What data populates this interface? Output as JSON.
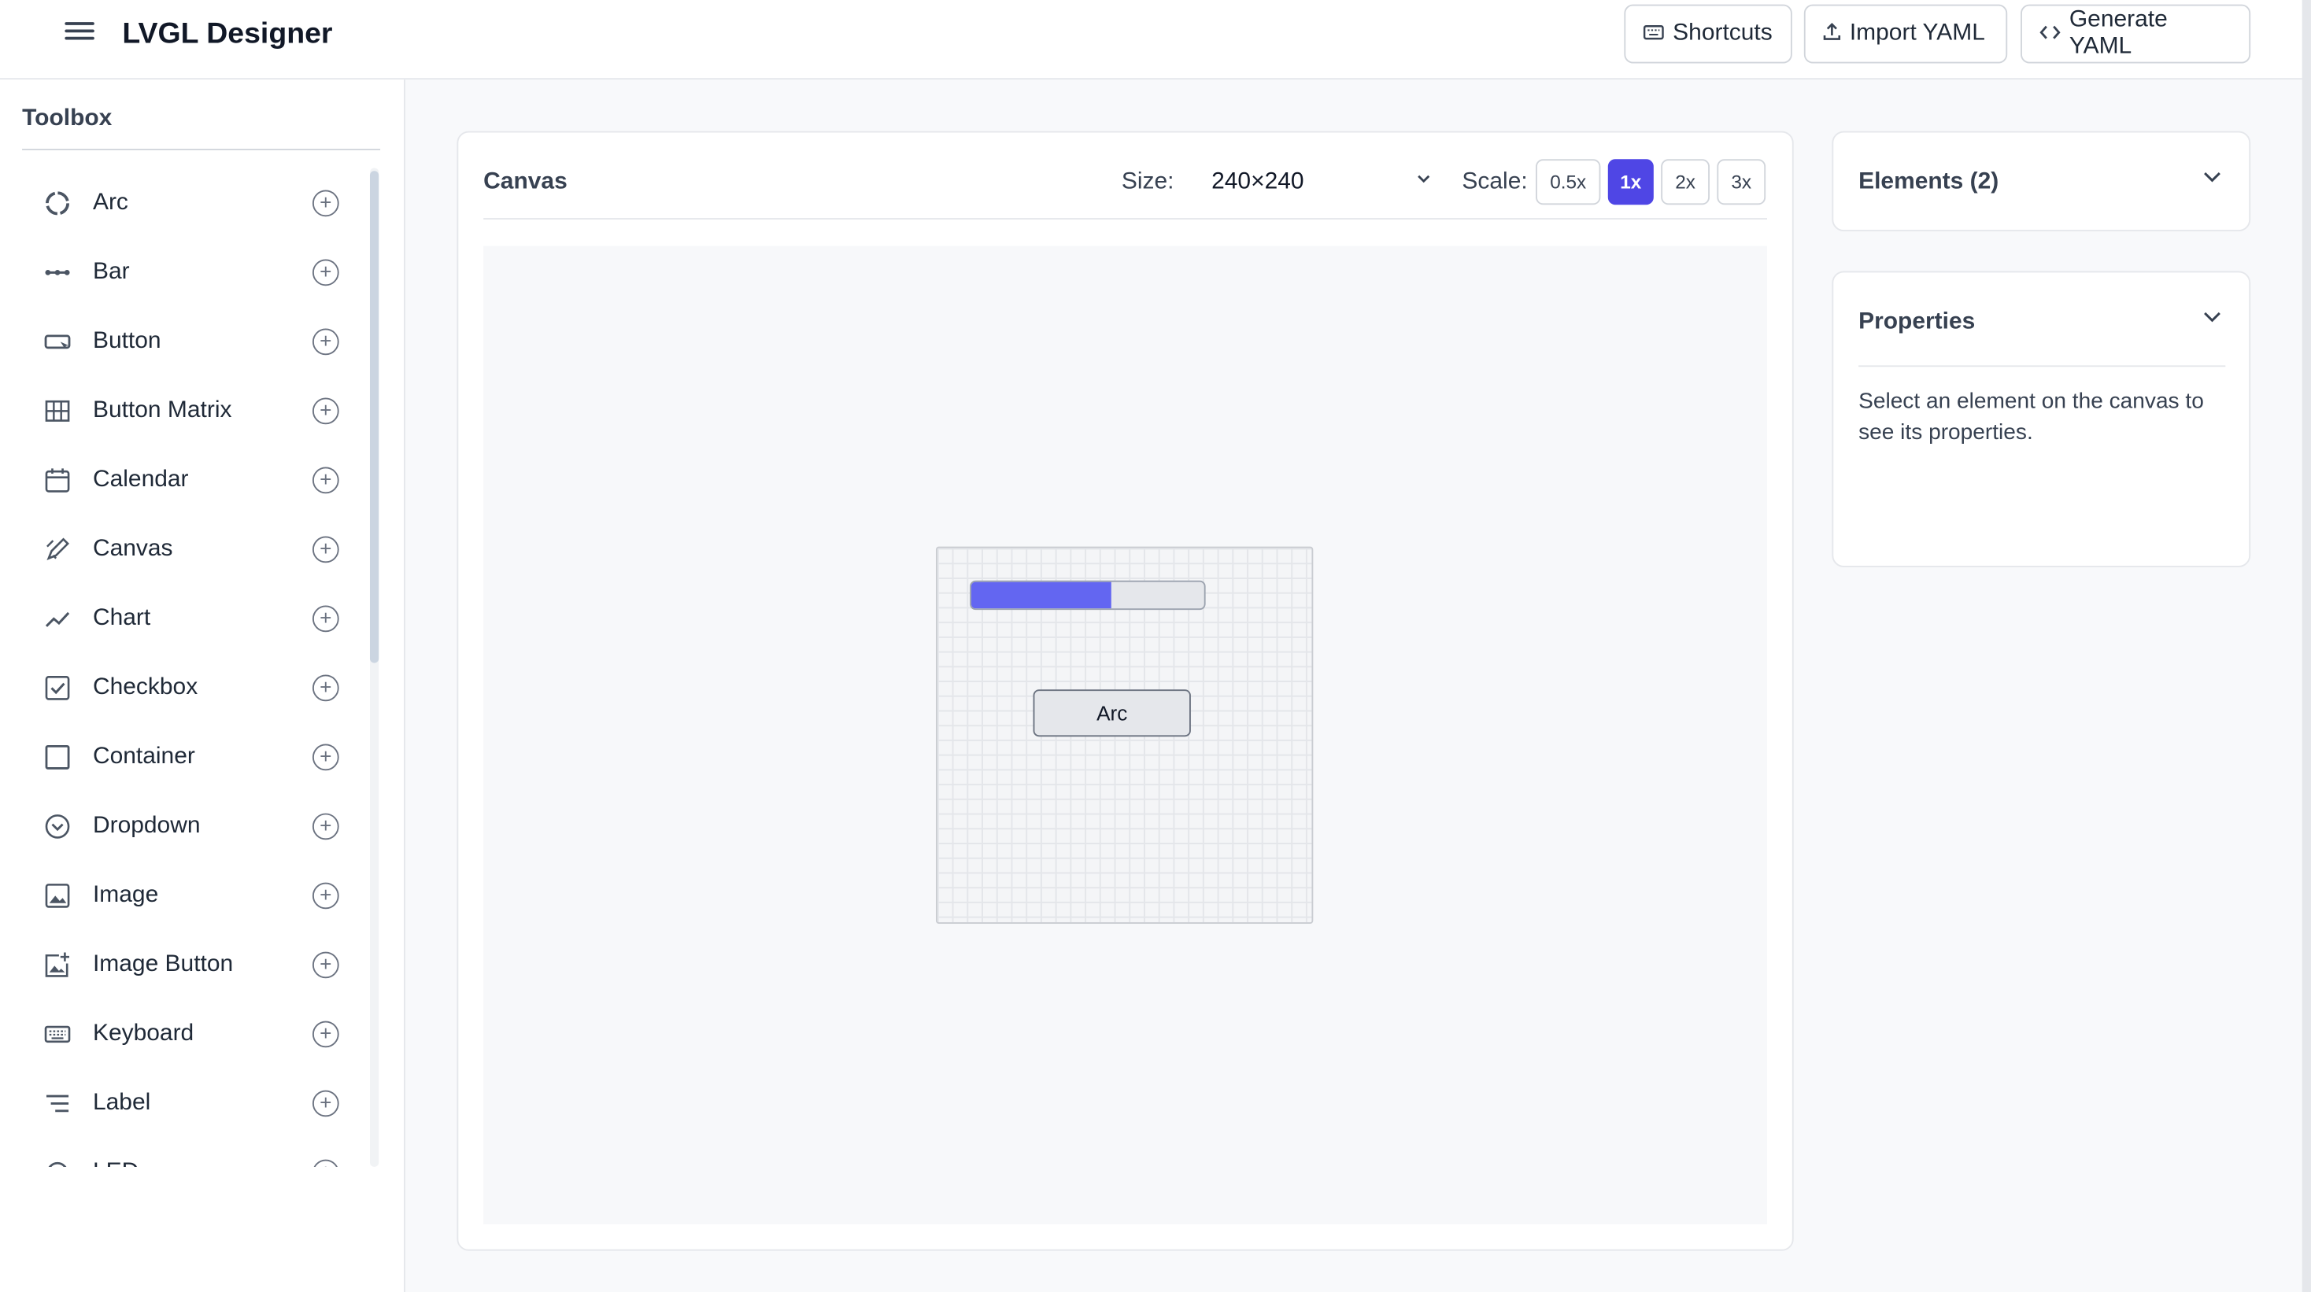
{
  "header": {
    "app_title": "LVGL Designer",
    "shortcuts_label": "Shortcuts",
    "import_label": "Import YAML",
    "generate_label": "Generate YAML"
  },
  "sidebar": {
    "title": "Toolbox",
    "items": [
      {
        "label": "Arc",
        "icon": "arc-icon"
      },
      {
        "label": "Bar",
        "icon": "bar-icon"
      },
      {
        "label": "Button",
        "icon": "button-icon"
      },
      {
        "label": "Button Matrix",
        "icon": "grid-icon"
      },
      {
        "label": "Calendar",
        "icon": "calendar-icon"
      },
      {
        "label": "Canvas",
        "icon": "brush-icon"
      },
      {
        "label": "Chart",
        "icon": "chart-icon"
      },
      {
        "label": "Checkbox",
        "icon": "checkbox-icon"
      },
      {
        "label": "Container",
        "icon": "square-icon"
      },
      {
        "label": "Dropdown",
        "icon": "dropdown-icon"
      },
      {
        "label": "Image",
        "icon": "image-icon"
      },
      {
        "label": "Image Button",
        "icon": "image-plus-icon"
      },
      {
        "label": "Keyboard",
        "icon": "keyboard-icon"
      },
      {
        "label": "Label",
        "icon": "text-icon"
      },
      {
        "label": "LED",
        "icon": "led-icon"
      }
    ]
  },
  "canvas": {
    "title": "Canvas",
    "size_label": "Size:",
    "size_value": "240×240",
    "scale_label": "Scale:",
    "scales": [
      "0.5x",
      "1x",
      "2x",
      "3x"
    ],
    "active_scale": "1x",
    "bar_value_fraction": 0.6,
    "arc_button_label": "Arc"
  },
  "elements_panel": {
    "title": "Elements (2)"
  },
  "properties_panel": {
    "title": "Properties",
    "empty_text": "Select an element on the canvas to see its properties."
  },
  "colors": {
    "accent": "#4f46e5",
    "bar_fill": "#6366f1"
  }
}
